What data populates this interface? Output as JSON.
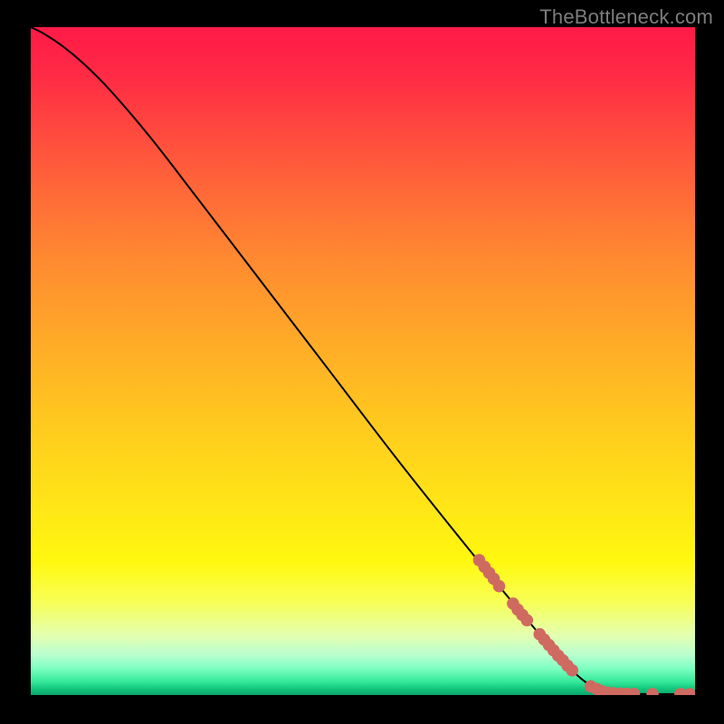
{
  "watermark": "TheBottleneck.com",
  "chart_data": {
    "type": "line",
    "title": "",
    "xlabel": "",
    "ylabel": "",
    "xlim": [
      0,
      100
    ],
    "ylim": [
      0,
      100
    ],
    "series": [
      {
        "name": "curve",
        "kind": "line",
        "points": [
          {
            "x": 0.0,
            "y": 100.0
          },
          {
            "x": 2.0,
            "y": 99.0
          },
          {
            "x": 5.0,
            "y": 97.0
          },
          {
            "x": 8.0,
            "y": 94.5
          },
          {
            "x": 12.0,
            "y": 90.5
          },
          {
            "x": 18.0,
            "y": 83.5
          },
          {
            "x": 25.0,
            "y": 74.5
          },
          {
            "x": 35.0,
            "y": 61.5
          },
          {
            "x": 45.0,
            "y": 48.5
          },
          {
            "x": 55.0,
            "y": 35.5
          },
          {
            "x": 65.0,
            "y": 23.0
          },
          {
            "x": 72.0,
            "y": 14.5
          },
          {
            "x": 78.0,
            "y": 7.5
          },
          {
            "x": 82.0,
            "y": 3.2
          },
          {
            "x": 85.0,
            "y": 1.1
          },
          {
            "x": 88.0,
            "y": 0.3
          },
          {
            "x": 92.0,
            "y": 0.15
          },
          {
            "x": 100.0,
            "y": 0.15
          }
        ]
      },
      {
        "name": "dots",
        "kind": "scatter",
        "points": [
          {
            "x": 67.5,
            "y": 20.2
          },
          {
            "x": 68.3,
            "y": 19.2
          },
          {
            "x": 69.0,
            "y": 18.3
          },
          {
            "x": 69.7,
            "y": 17.4
          },
          {
            "x": 70.5,
            "y": 16.3
          },
          {
            "x": 72.6,
            "y": 13.7
          },
          {
            "x": 73.3,
            "y": 12.8
          },
          {
            "x": 74.0,
            "y": 12.0
          },
          {
            "x": 74.7,
            "y": 11.2
          },
          {
            "x": 76.6,
            "y": 9.1
          },
          {
            "x": 77.3,
            "y": 8.3
          },
          {
            "x": 78.0,
            "y": 7.5
          },
          {
            "x": 78.7,
            "y": 6.7
          },
          {
            "x": 79.4,
            "y": 5.9
          },
          {
            "x": 80.1,
            "y": 5.2
          },
          {
            "x": 80.8,
            "y": 4.4
          },
          {
            "x": 81.5,
            "y": 3.7
          },
          {
            "x": 84.3,
            "y": 1.3
          },
          {
            "x": 85.2,
            "y": 0.9
          },
          {
            "x": 86.0,
            "y": 0.55
          },
          {
            "x": 86.8,
            "y": 0.37
          },
          {
            "x": 87.7,
            "y": 0.27
          },
          {
            "x": 88.7,
            "y": 0.22
          },
          {
            "x": 89.7,
            "y": 0.2
          },
          {
            "x": 90.8,
            "y": 0.18
          },
          {
            "x": 93.6,
            "y": 0.16
          },
          {
            "x": 97.8,
            "y": 0.15
          },
          {
            "x": 99.2,
            "y": 0.15
          }
        ]
      }
    ],
    "colors": {
      "line": "#000000",
      "dots": "#cf6a61"
    }
  }
}
